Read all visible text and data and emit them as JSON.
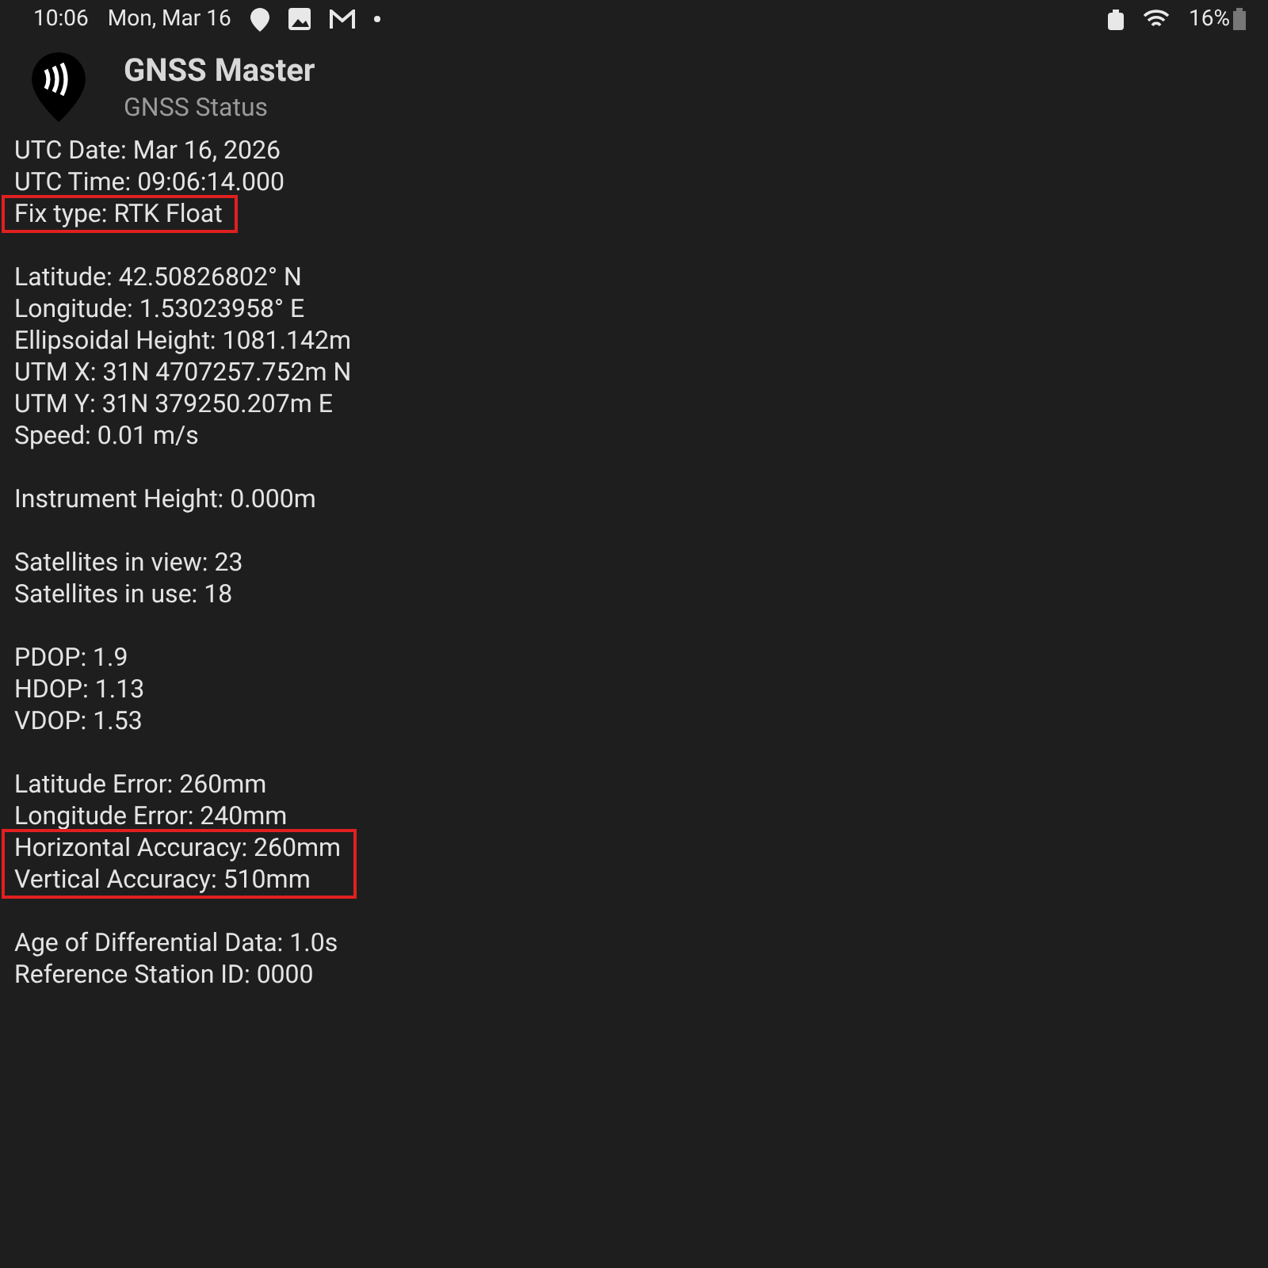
{
  "status_bar": {
    "time": "10:06",
    "date": "Mon, Mar 16",
    "battery": "16%"
  },
  "app_bar": {
    "title": "GNSS Master",
    "subtitle": "GNSS Status"
  },
  "groups": [
    {
      "lines": [
        {
          "text": "UTC Date: Mar 16, 2026",
          "highlighted": false
        },
        {
          "text": "UTC Time: 09:06:14.000",
          "highlighted": false
        },
        {
          "text": "Fix type: RTK Float",
          "highlighted": true
        }
      ]
    },
    {
      "lines": [
        {
          "text": "Latitude: 42.50826802° N",
          "highlighted": false
        },
        {
          "text": "Longitude: 1.53023958° E",
          "highlighted": false
        },
        {
          "text": "Ellipsoidal Height: 1081.142m",
          "highlighted": false
        },
        {
          "text": "UTM X: 31N 4707257.752m N",
          "highlighted": false
        },
        {
          "text": "UTM Y: 31N 379250.207m E",
          "highlighted": false
        },
        {
          "text": "Speed: 0.01 m/s",
          "highlighted": false
        }
      ]
    },
    {
      "lines": [
        {
          "text": "Instrument Height: 0.000m",
          "highlighted": false
        }
      ]
    },
    {
      "lines": [
        {
          "text": "Satellites in view: 23",
          "highlighted": false
        },
        {
          "text": "Satellites in use: 18",
          "highlighted": false
        }
      ]
    },
    {
      "lines": [
        {
          "text": "PDOP: 1.9",
          "highlighted": false
        },
        {
          "text": "HDOP: 1.13",
          "highlighted": false
        },
        {
          "text": "VDOP: 1.53",
          "highlighted": false
        }
      ]
    },
    {
      "lines": [
        {
          "text": "Latitude Error: 260mm",
          "highlighted": false
        },
        {
          "text": "Longitude Error: 240mm",
          "highlighted": false
        },
        {
          "text": "Horizontal Accuracy: 260mm",
          "highlighted": true
        },
        {
          "text": "Vertical Accuracy: 510mm",
          "highlighted": true
        }
      ]
    },
    {
      "lines": [
        {
          "text": "Age of Differential Data: 1.0s",
          "highlighted": false
        },
        {
          "text": "Reference Station ID: 0000",
          "highlighted": false
        }
      ]
    }
  ]
}
